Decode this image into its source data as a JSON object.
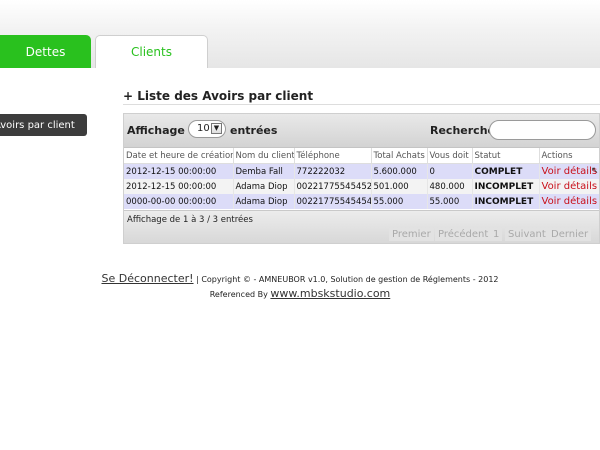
{
  "tabs": [
    {
      "label": "Dettes"
    },
    {
      "label": "Clients"
    }
  ],
  "sidebar": {
    "item_label": "Avoirs par client"
  },
  "section": {
    "title": "+ Liste des Avoirs par client"
  },
  "toolbar": {
    "show_label_before": "Affichage de",
    "page_size": "10",
    "show_label_after": "entrées",
    "search_label": "Rechercher:",
    "search_value": ""
  },
  "table": {
    "columns": [
      "Date et heure de création",
      "Nom du client",
      "Téléphone",
      "Total Achats",
      "Vous doit",
      "Statut",
      "Actions"
    ],
    "rows": [
      {
        "date": "2012-12-15 00:00:00",
        "client": "Demba Fall",
        "phone": "772222032",
        "total": "5.600.000",
        "owed": "0",
        "status": "COMPLET",
        "action": "Voir détails"
      },
      {
        "date": "2012-12-15 00:00:00",
        "client": "Adama Diop",
        "phone": "00221775545452",
        "total": "501.000",
        "owed": "480.000",
        "status": "INCOMPLET",
        "action": "Voir détails"
      },
      {
        "date": "0000-00-00 00:00:00",
        "client": "Adama Diop",
        "phone": "00221775545454",
        "total": "55.000",
        "owed": "55.000",
        "status": "INCOMPLET",
        "action": "Voir détails"
      }
    ]
  },
  "pagination": {
    "info": "Affichage de 1 à 3 / 3 entrées",
    "first": "Premier",
    "previous": "Précédent",
    "current": "1",
    "next": "Suivant",
    "last": "Dernier"
  },
  "footer": {
    "logout": "Se Déconnecter!",
    "copyright": "| Copyright © - AMNEUBOR v1.0, Solution de gestion de Réglements - 2012",
    "referenced_by": "Referenced By",
    "site": "www.mbskstudio.com"
  },
  "colors": {
    "accent": "#29c11e",
    "status_complete": "#1a9a1a",
    "status_incomplete": "#e8141b",
    "link": "#c8101a"
  }
}
